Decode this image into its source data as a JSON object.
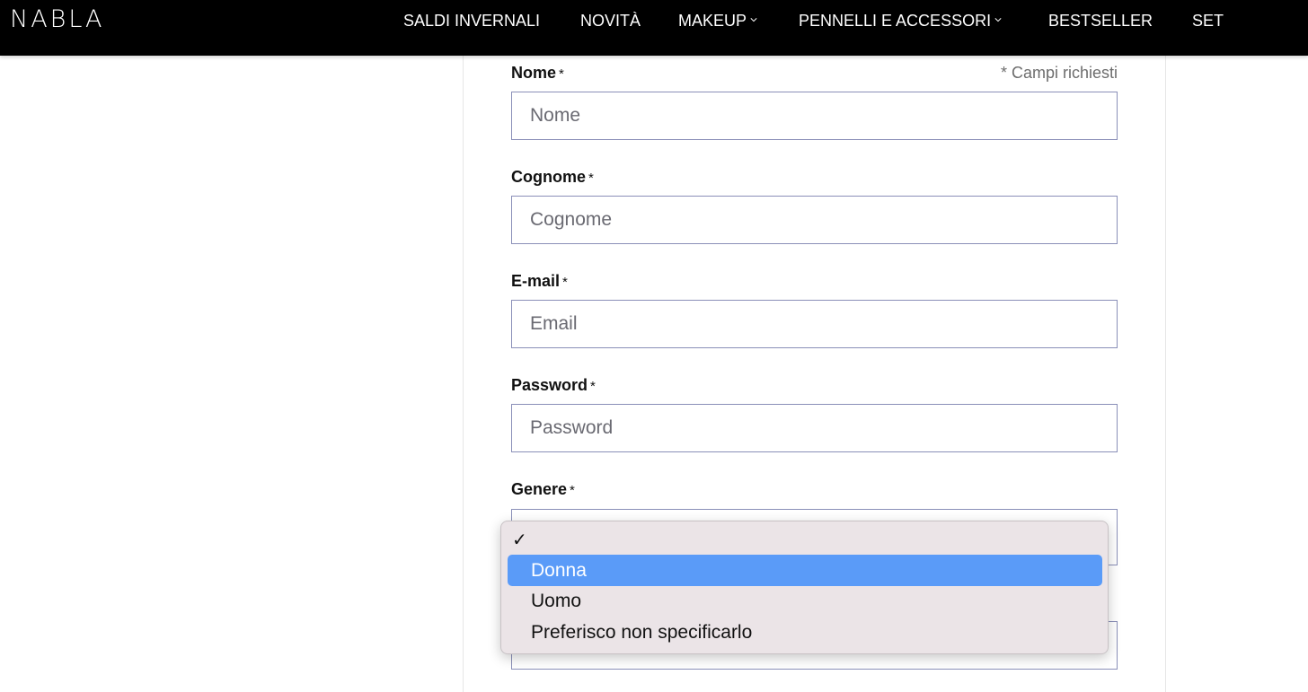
{
  "header": {
    "logo": "NABLA",
    "nav": [
      {
        "label": "SALDI INVERNALI"
      },
      {
        "label": "NOVITÀ"
      },
      {
        "label": "MAKEUP"
      },
      {
        "label": "PENNELLI E ACCESSORI"
      },
      {
        "label": "BESTSELLER"
      },
      {
        "label": "SET"
      }
    ]
  },
  "form": {
    "required_note": "* Campi richiesti",
    "required_mark": "*",
    "fields": [
      {
        "label": "Nome",
        "placeholder": "Nome",
        "value": ""
      },
      {
        "label": "Cognome",
        "placeholder": "Cognome",
        "value": ""
      },
      {
        "label": "E-mail",
        "placeholder": "Email",
        "value": ""
      },
      {
        "label": "Password",
        "placeholder": "Password",
        "value": ""
      }
    ],
    "gender": {
      "label": "Genere",
      "checkmark": "✓",
      "options": [
        "Donna",
        "Uomo",
        "Preferisco non specificarlo"
      ],
      "highlighted": "Donna"
    }
  },
  "colors": {
    "nav_bg": "#000000",
    "field_border": "#8a8fb8",
    "dropdown_bg": "#ebe4e7",
    "highlight": "#5a9bf8"
  }
}
